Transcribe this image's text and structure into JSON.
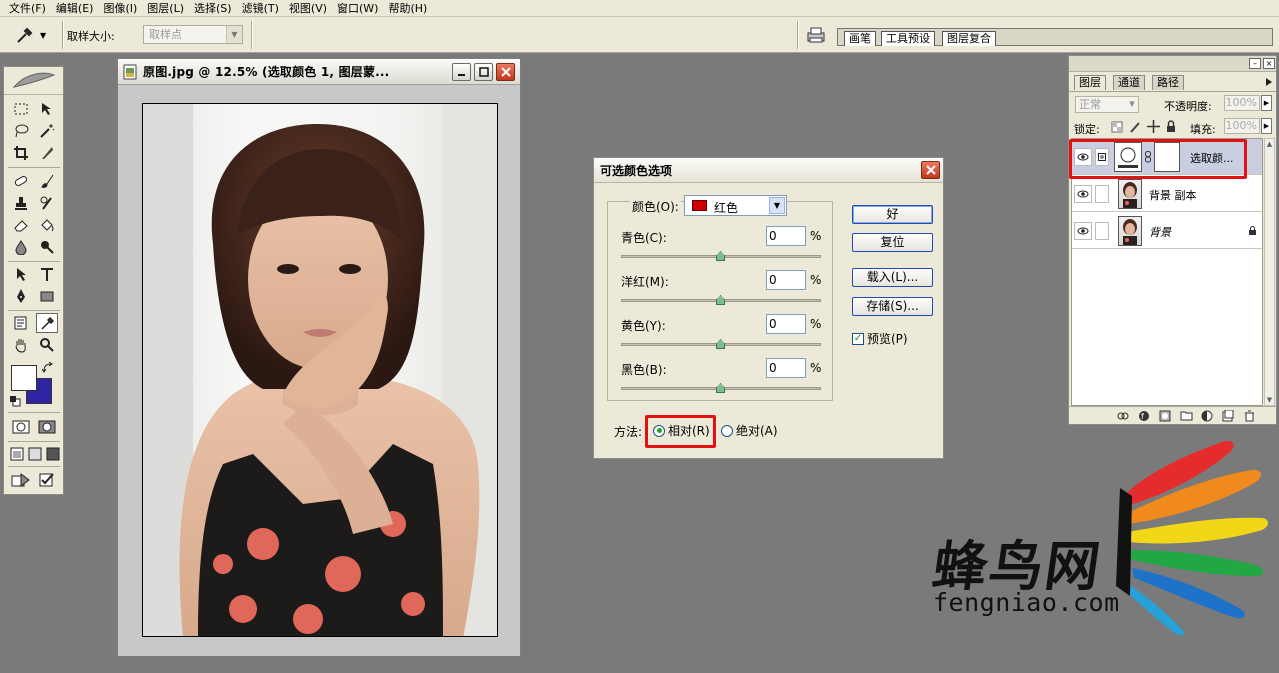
{
  "menubar": {
    "items": [
      "文件(F)",
      "编辑(E)",
      "图像(I)",
      "图层(L)",
      "选择(S)",
      "滤镜(T)",
      "视图(V)",
      "窗口(W)",
      "帮助(H)"
    ]
  },
  "options": {
    "sample_size_label": "取样大小:",
    "sample_size_value": "取样点",
    "palette_well_tabs": [
      "画笔",
      "工具预设",
      "图层复合"
    ]
  },
  "document": {
    "title": "原图.jpg @ 12.5% (选取颜色 1, 图层蒙..."
  },
  "dialog": {
    "title": "可选颜色选项",
    "colors_label": "颜色(O):",
    "color_value": "红色",
    "sliders": [
      {
        "label": "青色(C):",
        "value": "0",
        "unit": "%",
        "position": 0.5
      },
      {
        "label": "洋红(M):",
        "value": "0",
        "unit": "%",
        "position": 0.5
      },
      {
        "label": "黄色(Y):",
        "value": "0",
        "unit": "%",
        "position": 0.5
      },
      {
        "label": "黑色(B):",
        "value": "0",
        "unit": "%",
        "position": 0.5
      }
    ],
    "buttons": {
      "ok": "好",
      "reset": "复位",
      "load": "载入(L)...",
      "save": "存储(S)..."
    },
    "preview_label": "预览(P)",
    "preview_checked": true,
    "method_label": "方法:",
    "method_relative": "相对(R)",
    "method_absolute": "绝对(A)",
    "method_selected": "relative"
  },
  "layers": {
    "tabs": [
      "图层",
      "通道",
      "路径"
    ],
    "blend_mode": "正常",
    "opacity_label": "不透明度:",
    "opacity_value": "100%",
    "lock_label": "锁定:",
    "fill_label": "填充:",
    "fill_value": "100%",
    "rows": [
      {
        "name": "选取颜...",
        "selected": true
      },
      {
        "name": "背景 副本",
        "selected": false
      },
      {
        "name": "背景",
        "selected": false
      }
    ]
  },
  "watermark": {
    "chinese": "蜂鸟网",
    "url": "fengniao.com"
  },
  "colors": {
    "highlight": "#e31212",
    "background_swatch": "#2e24a4",
    "foreground_swatch": "#ffffff"
  }
}
